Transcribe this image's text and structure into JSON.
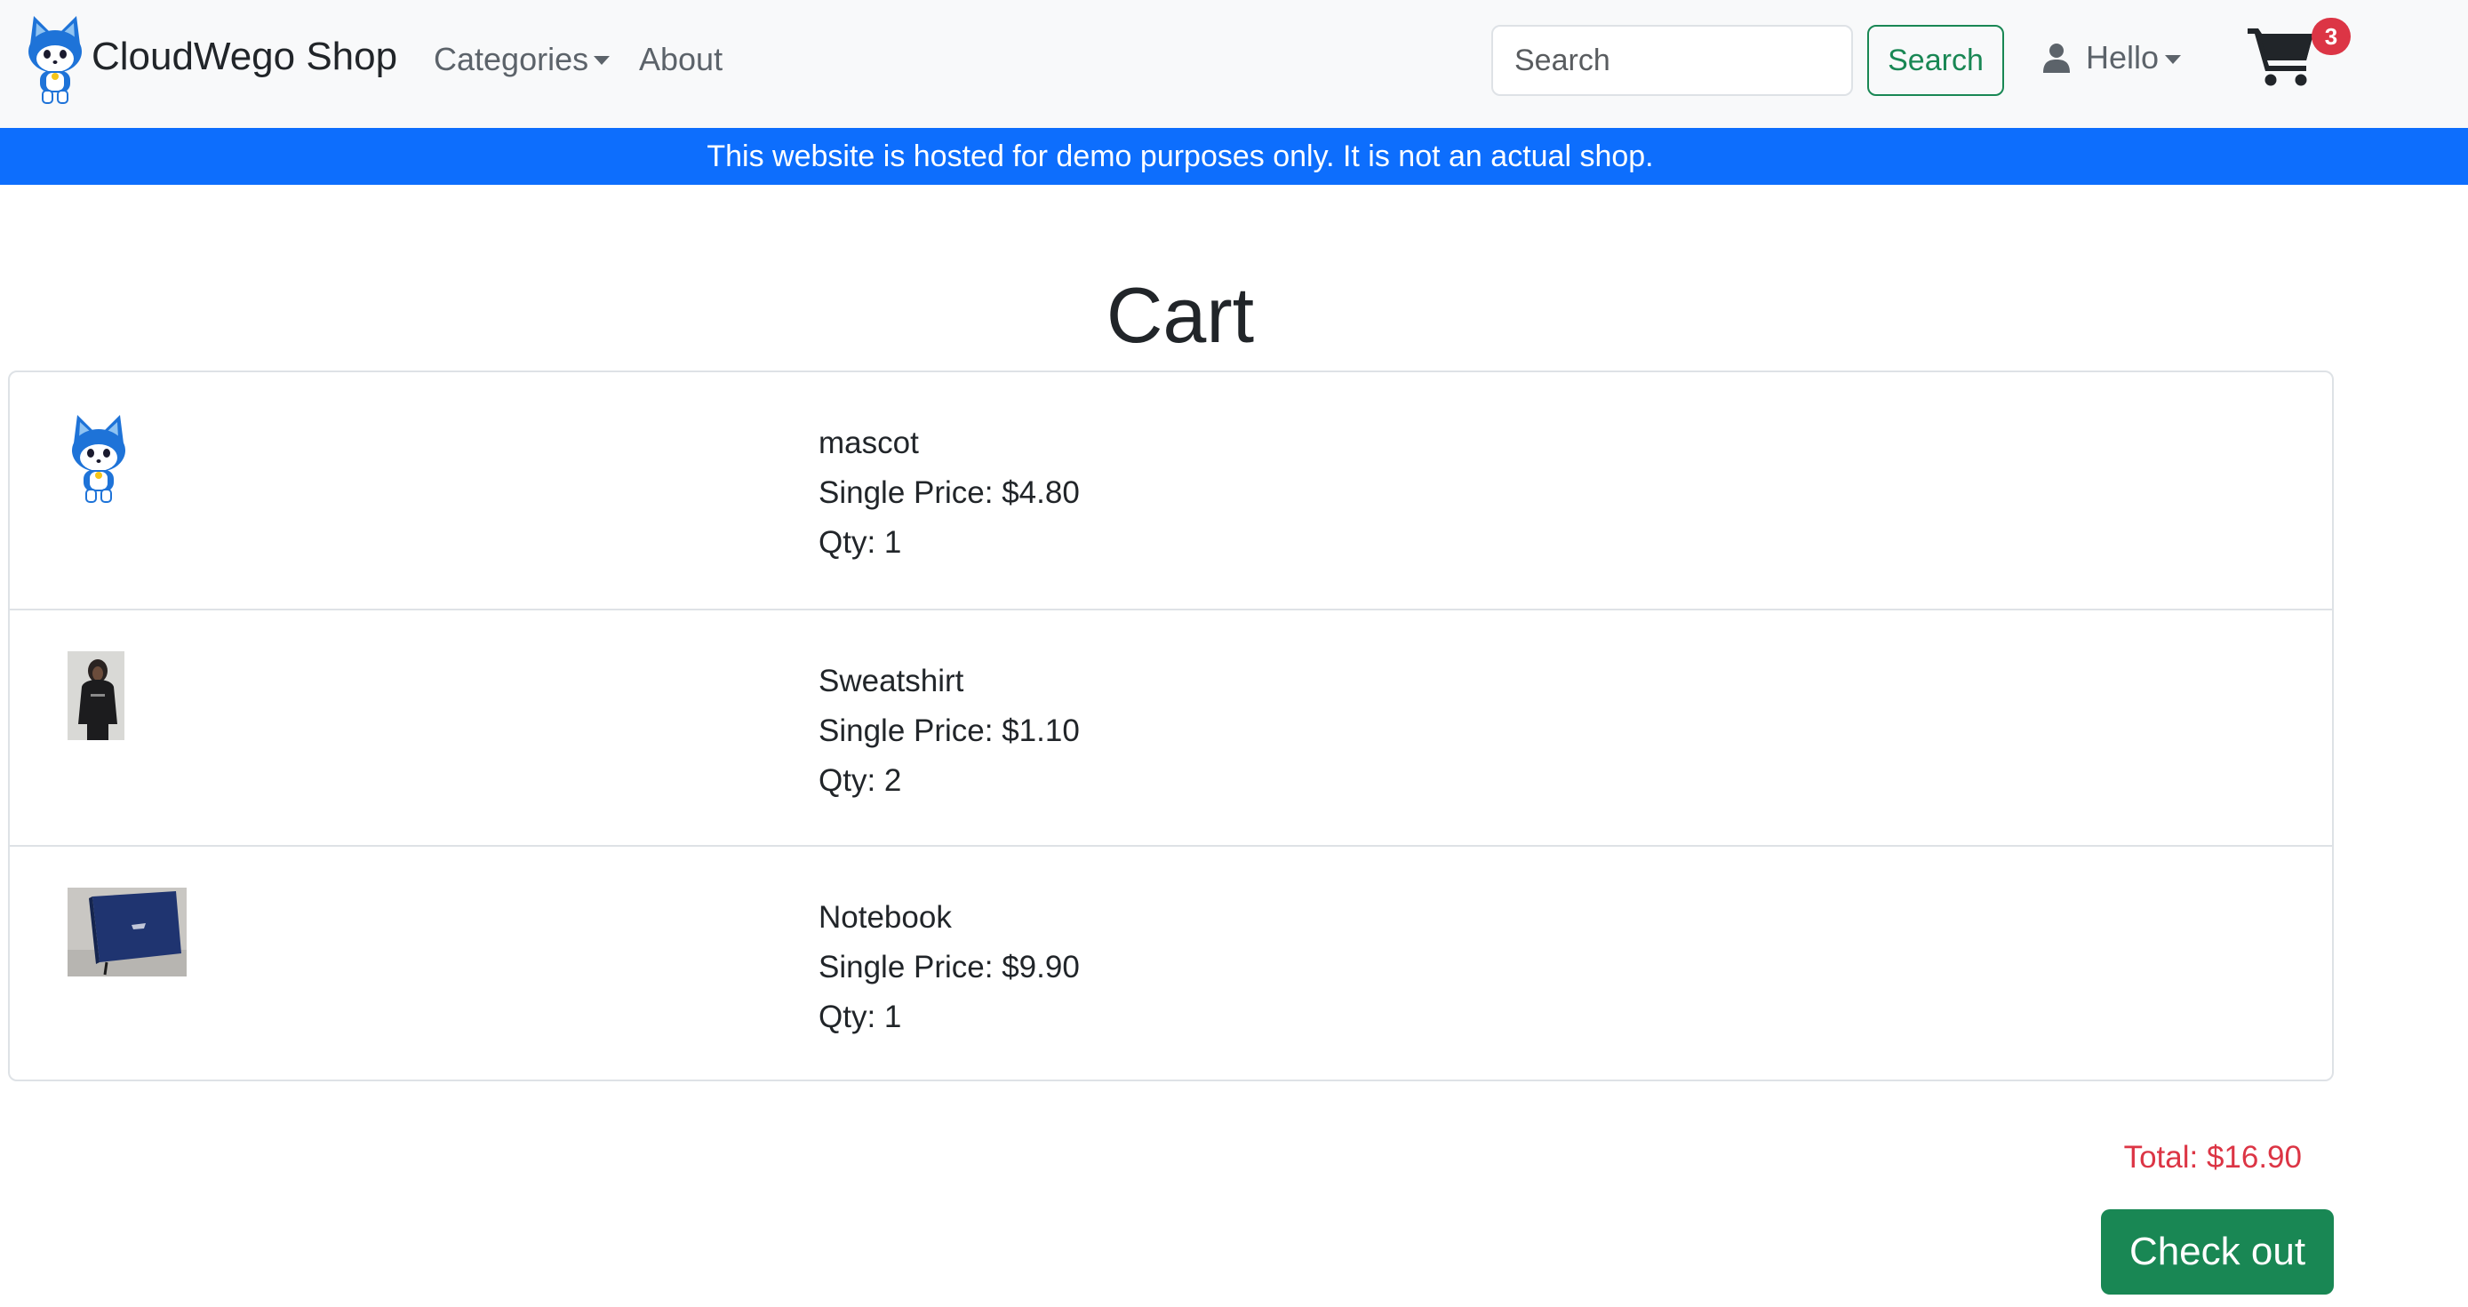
{
  "navbar": {
    "brand": "CloudWego Shop",
    "categories_label": "Categories",
    "about_label": "About",
    "search_placeholder": "Search",
    "search_button": "Search",
    "user_label": "Hello",
    "cart_count": "3"
  },
  "banner": {
    "text": "This website is hosted for demo purposes only. It is not an actual shop."
  },
  "cart": {
    "title": "Cart",
    "items": [
      {
        "name": "mascot",
        "price": "Single Price: $4.80",
        "qty": "Qty: 1",
        "image_icon": "mascot-icon"
      },
      {
        "name": "Sweatshirt",
        "price": "Single Price: $1.10",
        "qty": "Qty: 2",
        "image_icon": "sweatshirt-photo"
      },
      {
        "name": "Notebook",
        "price": "Single Price: $9.90",
        "qty": "Qty: 1",
        "image_icon": "notebook-photo"
      }
    ],
    "total": "Total: $16.90",
    "checkout_label": "Check out"
  },
  "colors": {
    "navbar_bg": "#f8f9fa",
    "banner_bg": "#0d6efd",
    "success": "#198754",
    "danger": "#dc3545",
    "border": "#dee2e6"
  }
}
